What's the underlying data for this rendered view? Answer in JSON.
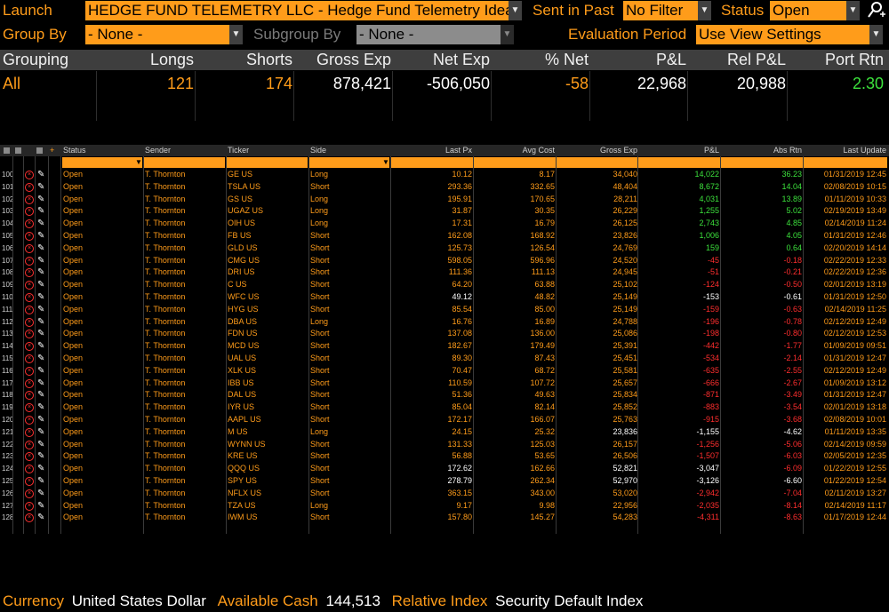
{
  "filters": {
    "launch_label": "Launch",
    "launch_value": "HEDGE FUND TELEMETRY LLC - Hedge Fund Telemetry Ideas",
    "sent_label": "Sent in Past",
    "sent_value": "No Filter",
    "status_label": "Status",
    "status_value": "Open",
    "groupby_label": "Group By",
    "groupby_value": "- None -",
    "subgroup_label": "Subgroup By",
    "subgroup_value": "- None -",
    "eval_label": "Evaluation Period",
    "eval_value": "Use View Settings"
  },
  "summary": {
    "headers": [
      "Grouping",
      "Longs",
      "Shorts",
      "Gross Exp",
      "Net Exp",
      "% Net",
      "P&L",
      "Rel P&L",
      "Port Rtn"
    ],
    "row": [
      "All",
      "121",
      "174",
      "878,421",
      "-506,050",
      "-58",
      "22,968",
      "20,988",
      "2.30"
    ]
  },
  "grid": {
    "headers": [
      "Status",
      "Sender",
      "Ticker",
      "Side",
      "Last Px",
      "Avg Cost",
      "Gross Exp",
      "P&L",
      "Abs Rtn",
      "Last Update"
    ],
    "rows": [
      {
        "n": "100",
        "status": "Open",
        "sender": "T. Thornton",
        "ticker": "GE US",
        "side": "Long",
        "last": "10.12",
        "avg": "8.17",
        "gross": "34,040",
        "pnl": "14,022",
        "abs": "36.23",
        "upd": "01/31/2019 12:45",
        "pc": "green",
        "ac": "green"
      },
      {
        "n": "101",
        "status": "Open",
        "sender": "T. Thornton",
        "ticker": "TSLA US",
        "side": "Short",
        "last": "293.36",
        "avg": "332.65",
        "gross": "48,404",
        "pnl": "8,672",
        "abs": "14.04",
        "upd": "02/08/2019 10:15",
        "pc": "green",
        "ac": "green"
      },
      {
        "n": "102",
        "status": "Open",
        "sender": "T. Thornton",
        "ticker": "GS US",
        "side": "Long",
        "last": "195.91",
        "avg": "170.65",
        "gross": "28,211",
        "pnl": "4,031",
        "abs": "13.89",
        "upd": "01/11/2019 10:33",
        "pc": "green",
        "ac": "green"
      },
      {
        "n": "103",
        "status": "Open",
        "sender": "T. Thornton",
        "ticker": "UGAZ US",
        "side": "Long",
        "last": "31.87",
        "avg": "30.35",
        "gross": "26,229",
        "pnl": "1,255",
        "abs": "5.02",
        "upd": "02/19/2019 13:49",
        "pc": "green",
        "ac": "green"
      },
      {
        "n": "104",
        "status": "Open",
        "sender": "T. Thornton",
        "ticker": "OIH US",
        "side": "Long",
        "last": "17.31",
        "avg": "16.79",
        "gross": "26,125",
        "pnl": "2,743",
        "abs": "4.85",
        "upd": "02/14/2019 11:24",
        "pc": "green",
        "ac": "green"
      },
      {
        "n": "105",
        "status": "Open",
        "sender": "T. Thornton",
        "ticker": "FB US",
        "side": "Short",
        "last": "162.08",
        "avg": "168.92",
        "gross": "23,826",
        "pnl": "1,006",
        "abs": "4.05",
        "upd": "01/31/2019 12:46",
        "pc": "green",
        "ac": "green"
      },
      {
        "n": "106",
        "status": "Open",
        "sender": "T. Thornton",
        "ticker": "GLD US",
        "side": "Short",
        "last": "125.73",
        "avg": "126.54",
        "gross": "24,769",
        "pnl": "159",
        "abs": "0.64",
        "upd": "02/20/2019 14:14",
        "pc": "green",
        "ac": "green"
      },
      {
        "n": "107",
        "status": "Open",
        "sender": "T. Thornton",
        "ticker": "CMG US",
        "side": "Short",
        "last": "598.05",
        "avg": "596.96",
        "gross": "24,520",
        "pnl": "-45",
        "abs": "-0.18",
        "upd": "02/22/2019 12:33",
        "pc": "red",
        "ac": "red"
      },
      {
        "n": "108",
        "status": "Open",
        "sender": "T. Thornton",
        "ticker": "DRI US",
        "side": "Short",
        "last": "111.36",
        "avg": "111.13",
        "gross": "24,945",
        "pnl": "-51",
        "abs": "-0.21",
        "upd": "02/22/2019 12:36",
        "pc": "red",
        "ac": "red"
      },
      {
        "n": "109",
        "status": "Open",
        "sender": "T. Thornton",
        "ticker": "C US",
        "side": "Short",
        "last": "64.20",
        "avg": "63.88",
        "gross": "25,102",
        "pnl": "-124",
        "abs": "-0.50",
        "upd": "02/01/2019 13:19",
        "pc": "red",
        "ac": "red"
      },
      {
        "n": "110",
        "status": "Open",
        "sender": "T. Thornton",
        "ticker": "WFC US",
        "side": "Short",
        "last": "49.12",
        "avg": "48.82",
        "gross": "25,149",
        "pnl": "-153",
        "abs": "-0.61",
        "upd": "01/31/2019 12:50",
        "pc": "white",
        "ac": "white",
        "lc": "white"
      },
      {
        "n": "111",
        "status": "Open",
        "sender": "T. Thornton",
        "ticker": "HYG US",
        "side": "Short",
        "last": "85.54",
        "avg": "85.00",
        "gross": "25,149",
        "pnl": "-159",
        "abs": "-0.63",
        "upd": "02/14/2019 11:25",
        "pc": "red",
        "ac": "red"
      },
      {
        "n": "112",
        "status": "Open",
        "sender": "T. Thornton",
        "ticker": "DBA US",
        "side": "Long",
        "last": "16.76",
        "avg": "16.89",
        "gross": "24,788",
        "pnl": "-196",
        "abs": "-0.78",
        "upd": "02/12/2019 12:49",
        "pc": "red",
        "ac": "red"
      },
      {
        "n": "113",
        "status": "Open",
        "sender": "T. Thornton",
        "ticker": "FDN US",
        "side": "Short",
        "last": "137.08",
        "avg": "136.00",
        "gross": "25,086",
        "pnl": "-198",
        "abs": "-0.80",
        "upd": "02/12/2019 12:53",
        "pc": "red",
        "ac": "red"
      },
      {
        "n": "114",
        "status": "Open",
        "sender": "T. Thornton",
        "ticker": "MCD US",
        "side": "Short",
        "last": "182.67",
        "avg": "179.49",
        "gross": "25,391",
        "pnl": "-442",
        "abs": "-1.77",
        "upd": "01/09/2019 09:51",
        "pc": "red",
        "ac": "red"
      },
      {
        "n": "115",
        "status": "Open",
        "sender": "T. Thornton",
        "ticker": "UAL US",
        "side": "Short",
        "last": "89.30",
        "avg": "87.43",
        "gross": "25,451",
        "pnl": "-534",
        "abs": "-2.14",
        "upd": "01/31/2019 12:47",
        "pc": "red",
        "ac": "red"
      },
      {
        "n": "116",
        "status": "Open",
        "sender": "T. Thornton",
        "ticker": "XLK US",
        "side": "Short",
        "last": "70.47",
        "avg": "68.72",
        "gross": "25,581",
        "pnl": "-635",
        "abs": "-2.55",
        "upd": "02/12/2019 12:49",
        "pc": "red",
        "ac": "red"
      },
      {
        "n": "117",
        "status": "Open",
        "sender": "T. Thornton",
        "ticker": "IBB US",
        "side": "Short",
        "last": "110.59",
        "avg": "107.72",
        "gross": "25,657",
        "pnl": "-666",
        "abs": "-2.67",
        "upd": "01/09/2019 13:12",
        "pc": "red",
        "ac": "red"
      },
      {
        "n": "118",
        "status": "Open",
        "sender": "T. Thornton",
        "ticker": "DAL US",
        "side": "Short",
        "last": "51.36",
        "avg": "49.63",
        "gross": "25,834",
        "pnl": "-871",
        "abs": "-3.49",
        "upd": "01/31/2019 12:47",
        "pc": "red",
        "ac": "red"
      },
      {
        "n": "119",
        "status": "Open",
        "sender": "T. Thornton",
        "ticker": "IYR US",
        "side": "Short",
        "last": "85.04",
        "avg": "82.14",
        "gross": "25,852",
        "pnl": "-883",
        "abs": "-3.54",
        "upd": "02/01/2019 13:18",
        "pc": "red",
        "ac": "red"
      },
      {
        "n": "120",
        "status": "Open",
        "sender": "T. Thornton",
        "ticker": "AAPL US",
        "side": "Short",
        "last": "172.17",
        "avg": "166.07",
        "gross": "25,763",
        "pnl": "-915",
        "abs": "-3.68",
        "upd": "02/08/2019 10:01",
        "pc": "red",
        "ac": "red"
      },
      {
        "n": "121",
        "status": "Open",
        "sender": "T. Thornton",
        "ticker": "M US",
        "side": "Long",
        "last": "24.15",
        "avg": "25.32",
        "gross": "23,836",
        "pnl": "-1,155",
        "abs": "-4.62",
        "upd": "01/11/2019 13:35",
        "pc": "white",
        "ac": "white",
        "gc": "white"
      },
      {
        "n": "122",
        "status": "Open",
        "sender": "T. Thornton",
        "ticker": "WYNN US",
        "side": "Short",
        "last": "131.33",
        "avg": "125.03",
        "gross": "26,157",
        "pnl": "-1,256",
        "abs": "-5.06",
        "upd": "02/14/2019 09:59",
        "pc": "red",
        "ac": "red"
      },
      {
        "n": "123",
        "status": "Open",
        "sender": "T. Thornton",
        "ticker": "KRE US",
        "side": "Short",
        "last": "56.88",
        "avg": "53.65",
        "gross": "26,506",
        "pnl": "-1,507",
        "abs": "-6.03",
        "upd": "02/05/2019 12:35",
        "pc": "red",
        "ac": "red"
      },
      {
        "n": "124",
        "status": "Open",
        "sender": "T. Thornton",
        "ticker": "QQQ US",
        "side": "Short",
        "last": "172.62",
        "avg": "162.66",
        "gross": "52,821",
        "pnl": "-3,047",
        "abs": "-6.09",
        "upd": "01/22/2019 12:55",
        "pc": "white",
        "ac": "red",
        "lc": "white",
        "gc": "white"
      },
      {
        "n": "125",
        "status": "Open",
        "sender": "T. Thornton",
        "ticker": "SPY US",
        "side": "Short",
        "last": "278.79",
        "avg": "262.34",
        "gross": "52,970",
        "pnl": "-3,126",
        "abs": "-6.60",
        "upd": "01/22/2019 12:54",
        "pc": "white",
        "ac": "white",
        "lc": "white",
        "gc": "white"
      },
      {
        "n": "126",
        "status": "Open",
        "sender": "T. Thornton",
        "ticker": "NFLX US",
        "side": "Short",
        "last": "363.15",
        "avg": "343.00",
        "gross": "53,020",
        "pnl": "-2,942",
        "abs": "-7.04",
        "upd": "02/11/2019 13:27",
        "pc": "red",
        "ac": "red"
      },
      {
        "n": "127",
        "status": "Open",
        "sender": "T. Thornton",
        "ticker": "TZA US",
        "side": "Long",
        "last": "9.17",
        "avg": "9.98",
        "gross": "22,956",
        "pnl": "-2,035",
        "abs": "-8.14",
        "upd": "02/14/2019 11:17",
        "pc": "red",
        "ac": "red"
      },
      {
        "n": "128",
        "status": "Open",
        "sender": "T. Thornton",
        "ticker": "IWM US",
        "side": "Short",
        "last": "157.80",
        "avg": "145.27",
        "gross": "54,283",
        "pnl": "-4,311",
        "abs": "-8.63",
        "upd": "01/17/2019 12:44",
        "pc": "red",
        "ac": "red"
      }
    ]
  },
  "footer": {
    "currency_label": "Currency",
    "currency_value": "United States Dollar",
    "cash_label": "Available Cash",
    "cash_value": "144,513",
    "index_label": "Relative Index",
    "index_value": "Security Default Index"
  },
  "colors": {
    "accent": "#ff9c1a",
    "positive": "#3ce13c",
    "negative": "#ff2e2e",
    "background": "#000000"
  }
}
